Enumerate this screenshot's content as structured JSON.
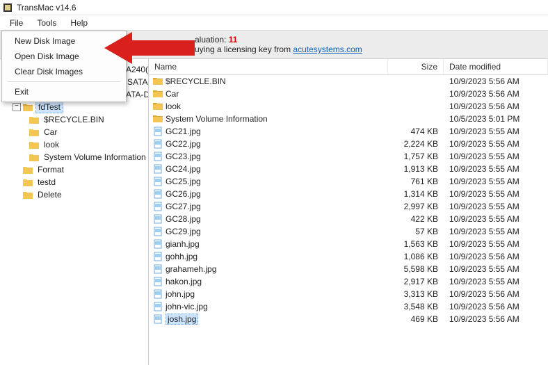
{
  "window": {
    "title": "TransMac v14.6"
  },
  "menu": {
    "file": "File",
    "tools": "Tools",
    "help": "Help",
    "file_items": {
      "new_disk_image": "New Disk Image",
      "open_disk_image": "Open Disk Image",
      "clear_disk_images": "Clear Disk Images",
      "exit": "Exit"
    }
  },
  "banner": {
    "prefix": "aluation:",
    "days": "11",
    "line2_pre": "uying a licensing key from ",
    "link": "acutesystems.com"
  },
  "tree": {
    "drive_fragment": "A240(",
    "sata": "SATA",
    "ata_d": "ATA-D",
    "fdtest": "fdTest",
    "recycle": "$RECYCLE.BIN",
    "car": "Car",
    "look": "look",
    "svi": "System Volume Information",
    "format": "Format",
    "testd": "testd",
    "delete": "Delete"
  },
  "columns": {
    "name": "Name",
    "size": "Size",
    "date": "Date modified"
  },
  "rows": [
    {
      "type": "folder",
      "name": "$RECYCLE.BIN",
      "size": "",
      "date": "10/9/2023 5:56 AM"
    },
    {
      "type": "folder",
      "name": "Car",
      "size": "",
      "date": "10/9/2023 5:56 AM"
    },
    {
      "type": "folder",
      "name": "look",
      "size": "",
      "date": "10/9/2023 5:56 AM"
    },
    {
      "type": "folder",
      "name": "System Volume Information",
      "size": "",
      "date": "10/5/2023 5:01 PM"
    },
    {
      "type": "file",
      "name": "GC21.jpg",
      "size": "474 KB",
      "date": "10/9/2023 5:55 AM"
    },
    {
      "type": "file",
      "name": "GC22.jpg",
      "size": "2,224 KB",
      "date": "10/9/2023 5:55 AM"
    },
    {
      "type": "file",
      "name": "GC23.jpg",
      "size": "1,757 KB",
      "date": "10/9/2023 5:55 AM"
    },
    {
      "type": "file",
      "name": "GC24.jpg",
      "size": "1,913 KB",
      "date": "10/9/2023 5:55 AM"
    },
    {
      "type": "file",
      "name": "GC25.jpg",
      "size": "761 KB",
      "date": "10/9/2023 5:55 AM"
    },
    {
      "type": "file",
      "name": "GC26.jpg",
      "size": "1,314 KB",
      "date": "10/9/2023 5:55 AM"
    },
    {
      "type": "file",
      "name": "GC27.jpg",
      "size": "2,997 KB",
      "date": "10/9/2023 5:55 AM"
    },
    {
      "type": "file",
      "name": "GC28.jpg",
      "size": "422 KB",
      "date": "10/9/2023 5:55 AM"
    },
    {
      "type": "file",
      "name": "GC29.jpg",
      "size": "57 KB",
      "date": "10/9/2023 5:55 AM"
    },
    {
      "type": "file",
      "name": "gianh.jpg",
      "size": "1,563 KB",
      "date": "10/9/2023 5:55 AM"
    },
    {
      "type": "file",
      "name": "gohh.jpg",
      "size": "1,086 KB",
      "date": "10/9/2023 5:56 AM"
    },
    {
      "type": "file",
      "name": "grahameh.jpg",
      "size": "5,598 KB",
      "date": "10/9/2023 5:55 AM"
    },
    {
      "type": "file",
      "name": "hakon.jpg",
      "size": "2,917 KB",
      "date": "10/9/2023 5:55 AM"
    },
    {
      "type": "file",
      "name": "john.jpg",
      "size": "3,313 KB",
      "date": "10/9/2023 5:56 AM"
    },
    {
      "type": "file",
      "name": "john-vic.jpg",
      "size": "3,548 KB",
      "date": "10/9/2023 5:56 AM"
    },
    {
      "type": "file",
      "name": "josh.jpg",
      "size": "469 KB",
      "date": "10/9/2023 5:56 AM",
      "selected": true
    }
  ]
}
